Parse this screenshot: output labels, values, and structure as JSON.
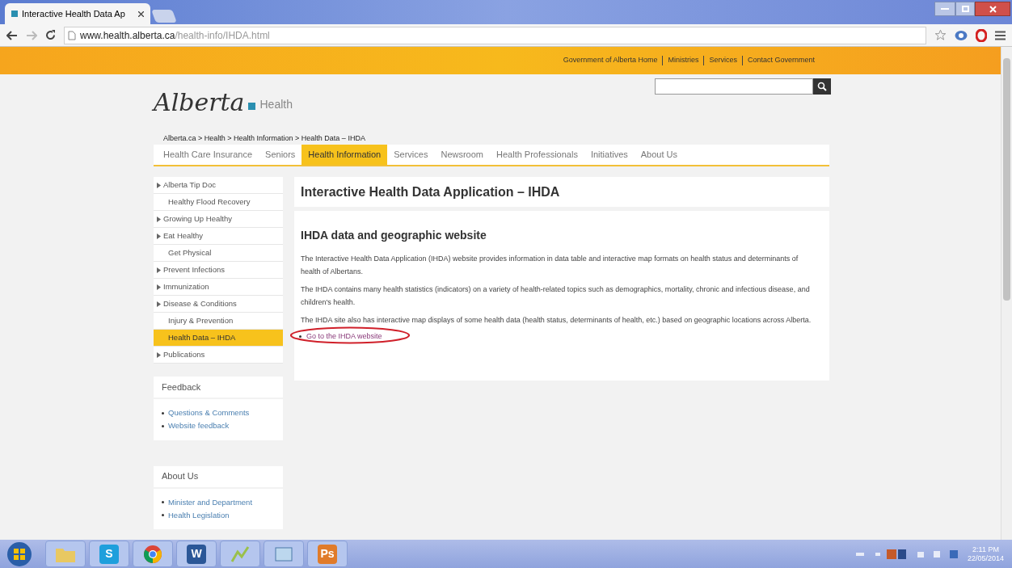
{
  "browser": {
    "tab_title": "Interactive Health Data Ap",
    "url_host": "www.health.alberta.ca",
    "url_path": "/health-info/IHDA.html"
  },
  "top_links": [
    "Government of Alberta Home",
    "Ministries",
    "Services",
    "Contact Government"
  ],
  "logo": {
    "script": "Alberta",
    "department": "Health"
  },
  "breadcrumb": "Alberta.ca > Health > Health Information > Health Data – IHDA",
  "nav": [
    {
      "label": "Health Care Insurance",
      "selected": false
    },
    {
      "label": "Seniors",
      "selected": false
    },
    {
      "label": "Health Information",
      "selected": true
    },
    {
      "label": "Services",
      "selected": false
    },
    {
      "label": "Newsroom",
      "selected": false
    },
    {
      "label": "Health Professionals",
      "selected": false
    },
    {
      "label": "Initiatives",
      "selected": false
    },
    {
      "label": "About Us",
      "selected": false
    }
  ],
  "sidebar": [
    {
      "label": "Alberta Tip Doc",
      "expandable": true,
      "selected": false
    },
    {
      "label": "Healthy Flood Recovery",
      "expandable": false,
      "selected": false
    },
    {
      "label": "Growing Up Healthy",
      "expandable": true,
      "selected": false
    },
    {
      "label": "Eat Healthy",
      "expandable": true,
      "selected": false
    },
    {
      "label": "Get Physical",
      "expandable": false,
      "selected": false
    },
    {
      "label": "Prevent Infections",
      "expandable": true,
      "selected": false
    },
    {
      "label": "Immunization",
      "expandable": true,
      "selected": false
    },
    {
      "label": "Disease & Conditions",
      "expandable": true,
      "selected": false
    },
    {
      "label": "Injury & Prevention",
      "expandable": false,
      "selected": false
    },
    {
      "label": "Health Data – IHDA",
      "expandable": false,
      "selected": true
    },
    {
      "label": "Publications",
      "expandable": true,
      "selected": false
    }
  ],
  "side_boxes": [
    {
      "title": "Feedback",
      "links": [
        "Questions & Comments",
        "Website feedback"
      ]
    },
    {
      "title": "About Us",
      "links": [
        "Minister and Department",
        "Health Legislation"
      ]
    }
  ],
  "page_title": "Interactive Health Data Application – IHDA",
  "section_title": "IHDA data and geographic website",
  "paragraphs": [
    "The Interactive Health Data Application (IHDA) website provides information in data table and interactive map formats on health status and determinants of health of Albertans.",
    "The IHDA contains many health statistics (indicators) on a variety of health-related topics such as demographics, mortality, chronic and infectious disease, and children's health.",
    "The IHDA site also has interactive map displays of some health data (health status, determinants of health, etc.) based on geographic locations across Alberta."
  ],
  "main_link": {
    "label": "Go to the IHDA website",
    "circled": true
  },
  "taskbar": [
    {
      "kind": "folder"
    },
    {
      "kind": "letter",
      "label": "S",
      "color": "#1e9fdc"
    },
    {
      "kind": "chrome"
    },
    {
      "kind": "letter",
      "label": "W",
      "color": "#2b5797"
    },
    {
      "kind": "chart"
    },
    {
      "kind": "window"
    },
    {
      "kind": "letter",
      "label": "Ps",
      "color": "#e07b2a"
    }
  ],
  "clock": {
    "time": "2:11 PM",
    "date": "22/05/2014"
  }
}
